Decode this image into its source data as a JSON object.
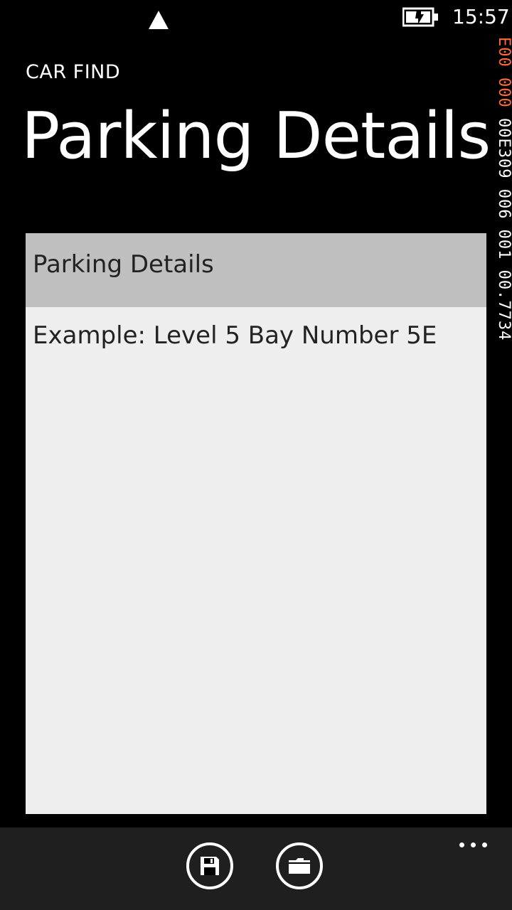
{
  "status_bar": {
    "time": "15:57",
    "icons": [
      "signal-icon",
      "battery-charging-icon"
    ]
  },
  "debug_counter": {
    "segments": [
      {
        "text": "E00",
        "color": "#ff6a3d"
      },
      {
        "text": " 000",
        "color": "#ff6a3d"
      },
      {
        "text": " 00E309",
        "color": "#ffffff"
      },
      {
        "text": " 006",
        "color": "#ffffff"
      },
      {
        "text": " 001",
        "color": "#ffffff"
      },
      {
        "text": " 00.7734",
        "color": "#ffffff"
      }
    ]
  },
  "header": {
    "app_title": "CAR FIND",
    "page_title": "Parking Details"
  },
  "details": {
    "header_label": "Parking Details",
    "text": "Example: Level 5 Bay Number 5E"
  },
  "app_bar": {
    "buttons": [
      {
        "icon": "save-icon"
      },
      {
        "icon": "folder-open-icon"
      }
    ],
    "more_icon": "more-icon"
  }
}
